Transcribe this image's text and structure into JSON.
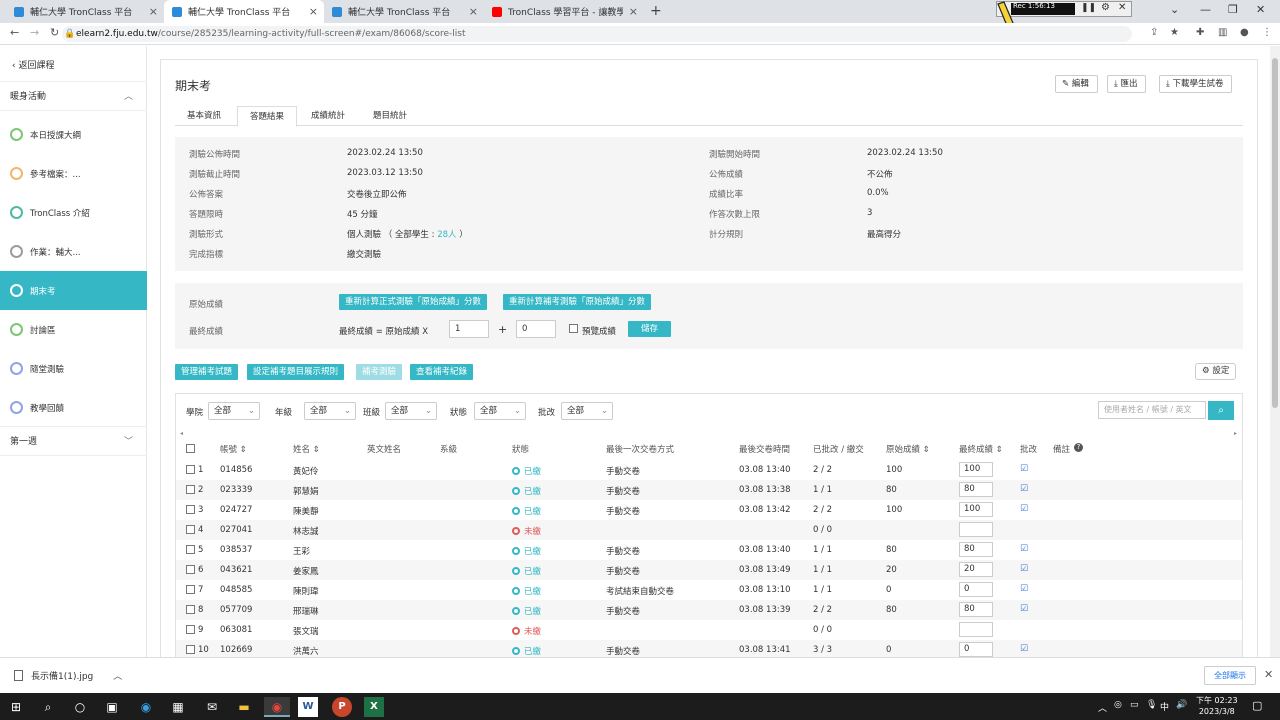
{
  "browser": {
    "tabs": [
      {
        "title": "輔仁大學 TronClass 平台",
        "color": "#2e8bd8"
      },
      {
        "title": "輔仁大學 TronClass 平台",
        "color": "#2e8bd8"
      },
      {
        "title": "輔仁大學 TronClass 平台",
        "color": "#2e8bd8"
      },
      {
        "title": "TronClass 學習平台 - 讓教學與學",
        "color": "#ff0000"
      }
    ],
    "new_tab": "+",
    "recorder": "Rec 1:56:13",
    "url_host": "elearn2.fju.edu.tw",
    "url_path": "/course/285235/learning-activity/full-screen#/exam/86068/score-list"
  },
  "sidebar": {
    "back": "返回課程",
    "section1": "暖身活動",
    "items": [
      {
        "label": "本日授課大綱",
        "color": "#7cc576"
      },
      {
        "label": "參考檔案：...",
        "color": "#f3b66b"
      },
      {
        "label": "TronClass 介紹",
        "color": "#4cb9a0"
      },
      {
        "label": "作業：輔大...",
        "color": "#9c9c9c"
      },
      {
        "label": "期末考",
        "color": "#ffffff"
      },
      {
        "label": "討論區",
        "color": "#7cc576"
      },
      {
        "label": "隨堂測驗",
        "color": "#8ea4e8"
      },
      {
        "label": "教學回饋",
        "color": "#8ea4e8"
      }
    ],
    "section2": "第一週"
  },
  "page": {
    "title": "期末考",
    "buttons": {
      "edit": "編輯",
      "export": "匯出",
      "download": "下載學生試卷"
    },
    "tabs": [
      "基本資訊",
      "答題結果",
      "成績統計",
      "題目統計"
    ],
    "info_left": [
      {
        "label": "測驗公佈時間",
        "value": "2023.02.24 13:50"
      },
      {
        "label": "測驗截止時間",
        "value": "2023.03.12 13:50"
      },
      {
        "label": "公佈答案",
        "value": "交卷後立即公佈"
      },
      {
        "label": "答題限時",
        "value": "45 分鐘"
      },
      {
        "label": "測驗形式",
        "value": "個人測驗 （ 全部學生 : ",
        "link": "28人",
        "tail": " ）"
      },
      {
        "label": "完成指標",
        "value": "繳交測驗"
      }
    ],
    "info_right": [
      {
        "label": "測驗開始時間",
        "value": "2023.02.24 13:50"
      },
      {
        "label": "公佈成績",
        "value": "不公佈"
      },
      {
        "label": "成績比率",
        "value": "0.0%"
      },
      {
        "label": "作答次數上限",
        "value": "3"
      },
      {
        "label": "計分規則",
        "value": "最高得分"
      }
    ],
    "score": {
      "raw_label": "原始成績",
      "btn_recalc_formal": "重新計算正式測驗「原始成績」分數",
      "btn_recalc_makeup": "重新計算補考測驗「原始成績」分數",
      "final_label": "最終成績",
      "formula": "最終成績 = 原始成績 X",
      "multiplier": "1",
      "plus": "+",
      "offset": "0",
      "preview": "預覽成績",
      "save": "儲存"
    },
    "actions": [
      "管理補考試題",
      "設定補考題目展示規則",
      "補考測驗",
      "查看補考紀錄"
    ],
    "settings": "設定",
    "filters": [
      {
        "label": "學院",
        "value": "全部"
      },
      {
        "label": "年級",
        "value": "全部"
      },
      {
        "label": "班級",
        "value": "全部"
      },
      {
        "label": "狀態",
        "value": "全部"
      },
      {
        "label": "批改",
        "value": "全部"
      }
    ],
    "search_placeholder": "使用者姓名 / 帳號 / 英文",
    "columns": [
      "帳號 ⇕",
      "姓名 ⇕",
      "英文姓名",
      "系級",
      "狀態",
      "最後一次交卷方式",
      "最後交卷時間",
      "已批改 / 繳交",
      "原始成績 ⇕",
      "最終成績 ⇕",
      "批改",
      "備註"
    ],
    "rows": [
      {
        "n": "1",
        "id": "014856",
        "name": "黃妃伶",
        "status": "已繳",
        "submitted": true,
        "method": "手動交卷",
        "time": "03.08 13:40",
        "graded": "2 / 2",
        "raw": "100",
        "final": "100",
        "check": true
      },
      {
        "n": "2",
        "id": "023339",
        "name": "郭慧娟",
        "status": "已繳",
        "submitted": true,
        "method": "手動交卷",
        "time": "03.08 13:38",
        "graded": "1 / 1",
        "raw": "80",
        "final": "80",
        "check": true
      },
      {
        "n": "3",
        "id": "024727",
        "name": "陳美靜",
        "status": "已繳",
        "submitted": true,
        "method": "手動交卷",
        "time": "03.08 13:42",
        "graded": "2 / 2",
        "raw": "100",
        "final": "100",
        "check": true
      },
      {
        "n": "4",
        "id": "027041",
        "name": "林志誠",
        "status": "未繳",
        "submitted": false,
        "method": "",
        "time": "",
        "graded": "0 / 0",
        "raw": "",
        "final": "",
        "check": false
      },
      {
        "n": "5",
        "id": "038537",
        "name": "王彩",
        "status": "已繳",
        "submitted": true,
        "method": "手動交卷",
        "time": "03.08 13:40",
        "graded": "1 / 1",
        "raw": "80",
        "final": "80",
        "check": true
      },
      {
        "n": "6",
        "id": "043621",
        "name": "姜家鳳",
        "status": "已繳",
        "submitted": true,
        "method": "手動交卷",
        "time": "03.08 13:49",
        "graded": "1 / 1",
        "raw": "20",
        "final": "20",
        "check": true
      },
      {
        "n": "7",
        "id": "048585",
        "name": "陳則瑋",
        "status": "已繳",
        "submitted": true,
        "method": "考試結束自動交卷",
        "time": "03.08 13:10",
        "graded": "1 / 1",
        "raw": "0",
        "final": "0",
        "check": true
      },
      {
        "n": "8",
        "id": "057709",
        "name": "邢瑞琳",
        "status": "已繳",
        "submitted": true,
        "method": "手動交卷",
        "time": "03.08 13:39",
        "graded": "2 / 2",
        "raw": "80",
        "final": "80",
        "check": true
      },
      {
        "n": "9",
        "id": "063081",
        "name": "張文瑞",
        "status": "未繳",
        "submitted": false,
        "method": "",
        "time": "",
        "graded": "0 / 0",
        "raw": "",
        "final": "",
        "check": false
      },
      {
        "n": "10",
        "id": "102669",
        "name": "洪萬六",
        "status": "已繳",
        "submitted": true,
        "method": "手動交卷",
        "time": "03.08 13:41",
        "graded": "3 / 3",
        "raw": "0",
        "final": "0",
        "check": true
      }
    ]
  },
  "download": {
    "file": "長示備1(1).jpg",
    "show_all": "全部顯示"
  },
  "taskbar": {
    "time": "下午 02:23",
    "date": "2023/3/8",
    "ime": "中"
  },
  "colors": {
    "accent": "#35b7c6",
    "submitted": "#35b7c6",
    "not_submitted": "#e05a5a"
  }
}
